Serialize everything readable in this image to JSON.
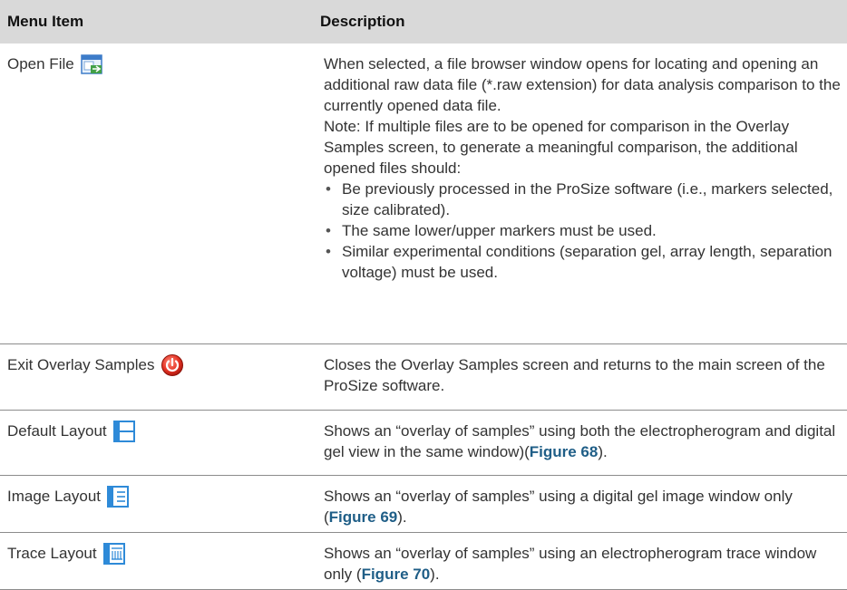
{
  "header": {
    "col1": "Menu Item",
    "col2": "Description"
  },
  "rows": [
    {
      "item": "Open File",
      "icon": "open-file-icon",
      "desc": {
        "p1": "When selected, a file browser window opens for locating and opening an additional raw data file (*.raw extension) for data analysis comparison to the currently opened data file.",
        "p2": "Note: If multiple files are to be opened for comparison in the Overlay Samples screen, to generate a meaningful comparison, the additional opened files should:",
        "bullets": [
          "Be previously processed in the ProSize software (i.e., markers selected, size calibrated).",
          "The same lower/upper markers must be used.",
          "Similar experimental conditions (separation gel, array length, separation voltage) must be used."
        ]
      }
    },
    {
      "item": "Exit Overlay Samples",
      "icon": "power-exit-icon",
      "desc": "Closes the Overlay Samples screen and returns to the main screen of the ProSize software."
    },
    {
      "item": "Default Layout",
      "icon": "default-layout-icon",
      "desc_before": "Shows an “overlay of samples” using both the electropherogram and digital gel view in the same window)(",
      "link": "Figure 68",
      "desc_after": ")."
    },
    {
      "item": "Image Layout",
      "icon": "image-layout-icon",
      "desc_before": "Shows an “overlay of samples” using a digital gel image window only (",
      "link": "Figure 69",
      "desc_after": ")."
    },
    {
      "item": "Trace Layout",
      "icon": "trace-layout-icon",
      "desc_before": "Shows an “overlay of samples” using an electropherogram trace window only (",
      "link": "Figure 70",
      "desc_after": ")."
    }
  ],
  "colors": {
    "header_bg": "#d9d9d9",
    "link": "#1f5e87",
    "rule": "#8c8c8c"
  }
}
